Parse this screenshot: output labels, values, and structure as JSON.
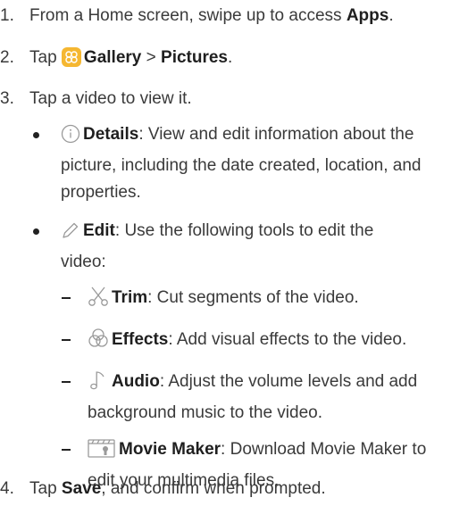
{
  "steps": [
    {
      "num": "1.",
      "pre": "From a Home screen, swipe up to access ",
      "bold": "Apps",
      "post": "."
    },
    {
      "num": "2.",
      "pre": "Tap ",
      "bold1": "Gallery",
      "sep": " > ",
      "bold2": "Pictures",
      "post": "."
    },
    {
      "num": "3.",
      "text": "Tap a video to view it."
    },
    {
      "num": "4.",
      "pre": "Tap ",
      "bold": "Save",
      "post": ", and confirm when prompted."
    }
  ],
  "bullets": [
    {
      "bold": "Details",
      "line1": ": View and edit information about the",
      "line2": "picture, including the date created, location, and",
      "line3": "properties."
    },
    {
      "bold": "Edit",
      "line1": ": Use the following tools to edit the",
      "line2": "video:"
    }
  ],
  "subitems": [
    {
      "bold": "Trim",
      "line1": ": Cut segments of the video."
    },
    {
      "bold": "Effects",
      "line1": ": Add visual effects to the video."
    },
    {
      "bold": "Audio",
      "line1": ": Adjust the volume levels and add",
      "line2": "background music to the video."
    },
    {
      "bold": "Movie Maker",
      "line1": ": Download Movie Maker to",
      "line2": "edit your multimedia files."
    }
  ],
  "colors": {
    "gallery_icon": "#f5b731",
    "text": "#3a3a3a",
    "icon_stroke": "#9a9a9a"
  },
  "icons": [
    "gallery-icon",
    "info-icon",
    "pencil-icon",
    "scissors-icon",
    "effects-icon",
    "music-note-icon",
    "movie-maker-icon"
  ]
}
